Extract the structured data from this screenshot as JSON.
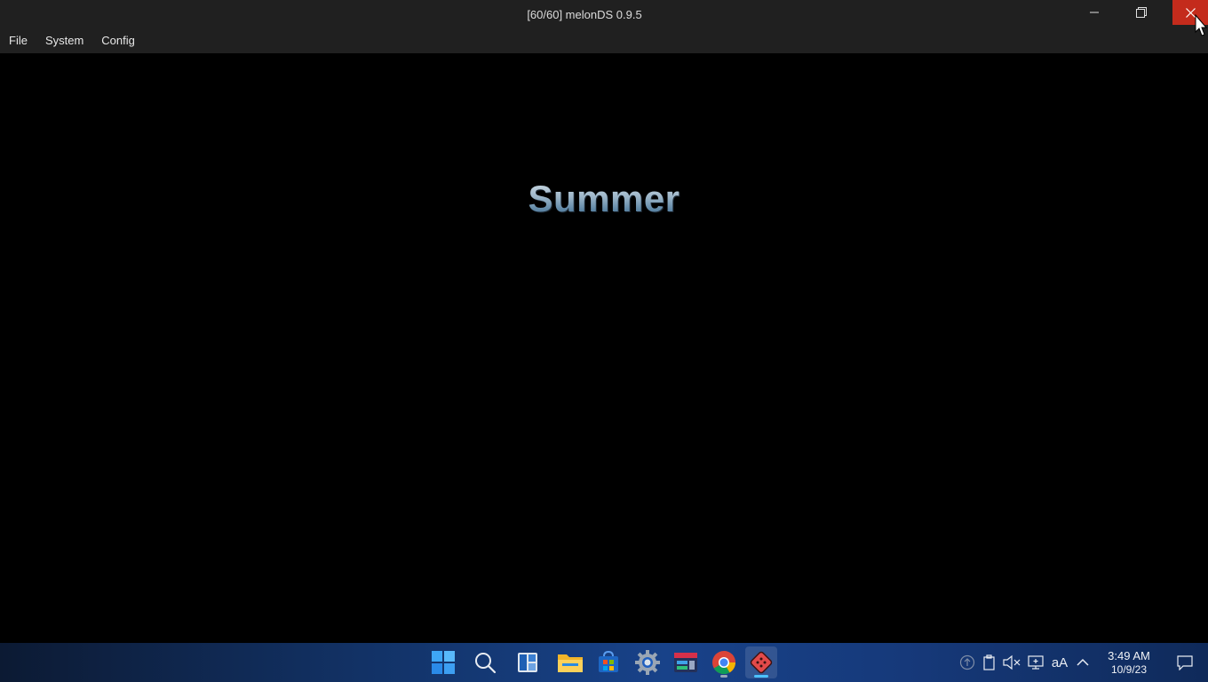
{
  "window": {
    "title": "[60/60] melonDS 0.9.5"
  },
  "menu": {
    "items": [
      "File",
      "System",
      "Config"
    ]
  },
  "game_screen": {
    "text": "Summer"
  },
  "taskbar": {
    "apps": [
      {
        "icon": "windows-start-icon"
      },
      {
        "icon": "search-icon"
      },
      {
        "icon": "widgets-icon"
      },
      {
        "icon": "file-explorer-icon"
      },
      {
        "icon": "microsoft-store-icon"
      },
      {
        "icon": "settings-gear-icon"
      },
      {
        "icon": "app-icon"
      },
      {
        "icon": "chrome-icon"
      },
      {
        "icon": "melonds-icon"
      }
    ],
    "tray": {
      "icons": [
        "update-icon",
        "clipboard-icon",
        "speaker-muted-icon",
        "display-icon",
        "font-size-icon",
        "chevron-up-icon",
        "notification-icon"
      ],
      "font_glyph": "aA"
    },
    "clock": {
      "time": "3:49 AM",
      "date": "10/9/23"
    }
  },
  "colors": {
    "close_button": "#c42b1c",
    "titlebar": "#202020",
    "accent_indicator": "#4cc2ff"
  }
}
